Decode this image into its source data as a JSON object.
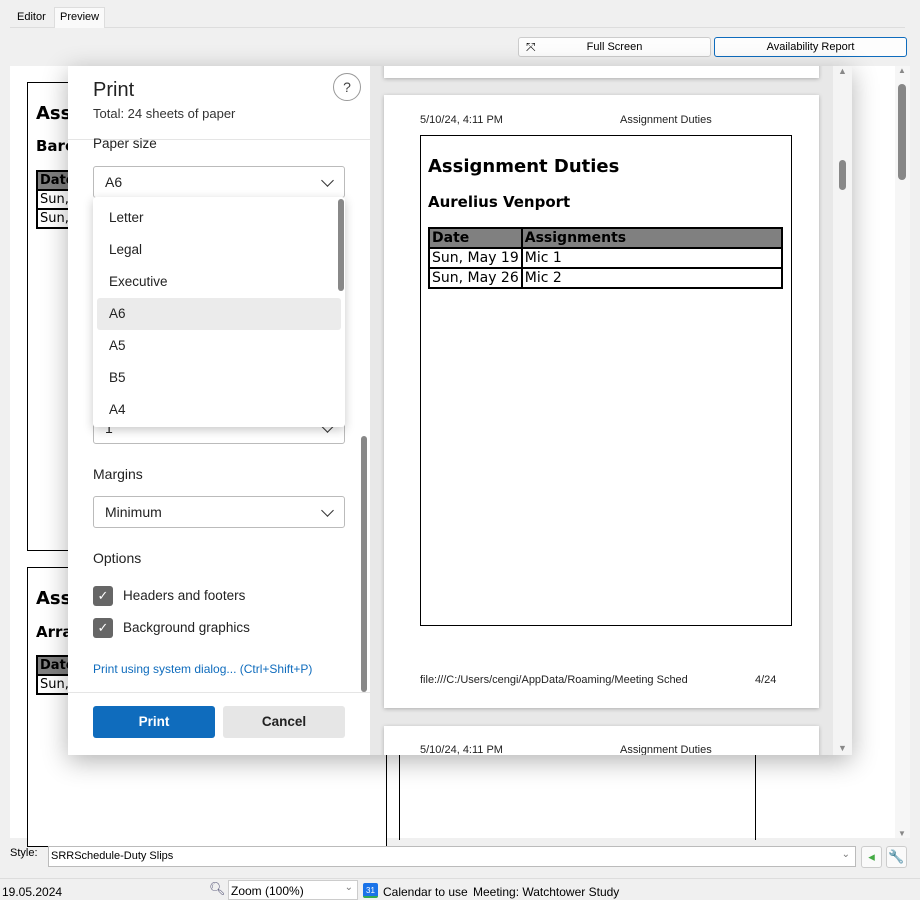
{
  "tabs": [
    {
      "label": "Editor"
    },
    {
      "label": "Preview"
    }
  ],
  "toolbar": {
    "full_screen": "Full Screen",
    "availability_report": "Availability Report"
  },
  "background_pages": [
    {
      "title": "Assi",
      "subtitle": "Barc",
      "header": "Date",
      "rows": [
        "Sun,",
        "Sun,"
      ]
    },
    {
      "title": "Assi",
      "subtitle": "Arra",
      "header": "Date",
      "rows": [
        "Sun,"
      ]
    }
  ],
  "print": {
    "title": "Print",
    "total": "Total: 24 sheets of paper",
    "help": "?",
    "paper_size_label": "Paper size",
    "paper_size_value": "A6",
    "paper_options": [
      "Letter",
      "Legal",
      "Executive",
      "A6",
      "A5",
      "B5",
      "A4"
    ],
    "selected_option": "A6",
    "hidden_select_value": "1",
    "margins_label": "Margins",
    "margins_value": "Minimum",
    "options_label": "Options",
    "options": [
      {
        "label": "Headers and footers",
        "checked": true
      },
      {
        "label": "Background graphics",
        "checked": true
      }
    ],
    "system_dialog_link": "Print using system dialog... (Ctrl+Shift+P)",
    "print_button": "Print",
    "cancel_button": "Cancel"
  },
  "preview_page": {
    "header_left": "5/10/24, 4:11 PM",
    "header_right": "Assignment Duties",
    "title": "Assignment Duties",
    "name": "Aurelius Venport",
    "columns": [
      "Date",
      "Assignments"
    ],
    "rows": [
      [
        "Sun, May 19",
        "Mic 1"
      ],
      [
        "Sun, May 26",
        "Mic 2"
      ]
    ],
    "footer_left": "file:///C:/Users/cengi/AppData/Roaming/Meeting Sched",
    "footer_right": "4/24"
  },
  "next_page": {
    "header_left": "5/10/24, 4:11 PM",
    "header_right": "Assignment Duties"
  },
  "style_row": {
    "label": "Style:",
    "value": "SRRSchedule-Duty Slips"
  },
  "status_bar": {
    "date": "19.05.2024",
    "zoom": "Zoom (100%)",
    "calendar": "Calendar to use",
    "calendar_day": "31",
    "meeting": "Meeting: Watchtower Study"
  },
  "colors": {
    "accent": "#0f6cbd",
    "checkbox": "#666666",
    "table_header": "#808080"
  }
}
